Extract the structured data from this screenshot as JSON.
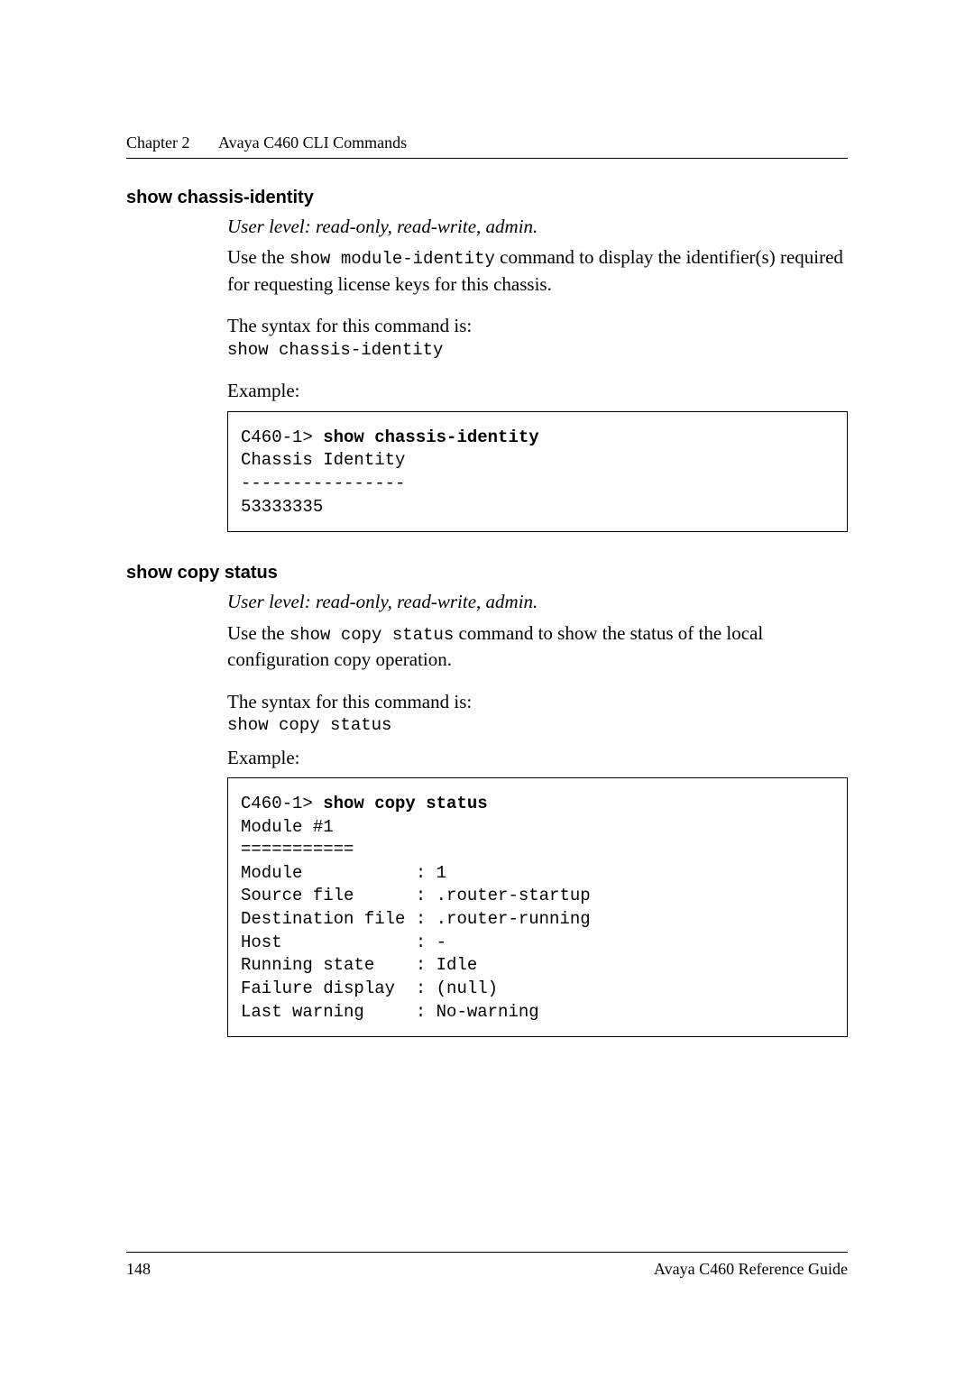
{
  "header": {
    "chapter": "Chapter 2",
    "title": "Avaya C460 CLI Commands"
  },
  "sections": [
    {
      "title": "show chassis-identity",
      "userlevel": "User level: read-only, read-write, admin.",
      "desc_pre": "Use the ",
      "desc_code": "show module-identity",
      "desc_post": " command to display the identifier(s) required for requesting license keys for this chassis.",
      "syntax_label": "The syntax for this command is:",
      "syntax_cmd": "show chassis-identity",
      "example_label": "Example:",
      "code_prompt": "C460-1> ",
      "code_cmd": "show chassis-identity",
      "code_body": "Chassis Identity\n----------------\n53333335"
    },
    {
      "title": "show copy status",
      "userlevel": "User level: read-only, read-write, admin.",
      "desc_pre": "Use the ",
      "desc_code": "show copy status",
      "desc_post": " command to show the status of the local configuration copy operation.",
      "syntax_label": "The syntax for this command is:",
      "syntax_cmd": "show copy status",
      "example_label": "Example:",
      "code_prompt": "C460-1> ",
      "code_cmd": "show copy status",
      "code_body": "Module #1\n===========\nModule           : 1\nSource file      : .router-startup\nDestination file : .router-running\nHost             : -\nRunning state    : Idle\nFailure display  : (null)\nLast warning     : No-warning"
    }
  ],
  "footer": {
    "page": "148",
    "book": "Avaya C460 Reference Guide"
  }
}
